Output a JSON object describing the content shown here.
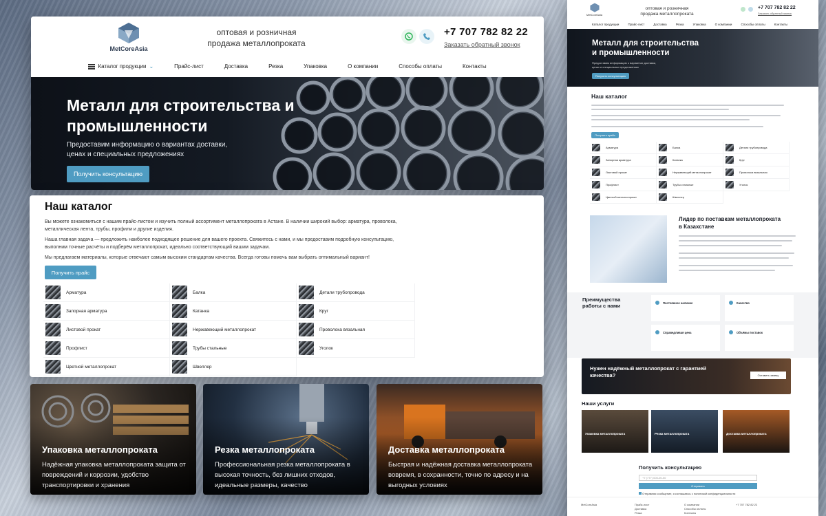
{
  "site": {
    "logo": "MetCoreAsia",
    "tagline": "оптовая и розничная продажа металлопроката",
    "phone": "+7 707 782 82 22",
    "callback": "Заказать обратный звонок",
    "nav": [
      "Каталог продукции",
      "Прайс-лист",
      "Доставка",
      "Резка",
      "Упаковка",
      "О компании",
      "Способы оплаты",
      "Контакты"
    ]
  },
  "hero": {
    "title": "Металл для строительства и промышленности",
    "subtitle": "Предоставим информацию о вариантах доставки, ценах и специальных предложениях",
    "button": "Получить консультацию"
  },
  "catalog": {
    "title": "Наш каталог",
    "p1": "Вы можете ознакомиться с нашим прайс-листом и изучить полный ассортимент металлопроката в Астане. В наличии широкий выбор: арматура, проволока, металлическая лента, трубы, профили и другие изделия.",
    "p2": "Наша главная задача — предложить наиболее подходящее решение для вашего проекта. Свяжитесь с нами, и мы предоставим подробную консультацию, выполним точные расчёты и подберём металлопрокат, идеально соответствующий вашим задачам.",
    "p3": "Мы предлагаем материалы, которые отвечают самым высоким стандартам качества. Всегда готовы помочь вам выбрать оптимальный вариант!",
    "button": "Получить прайс",
    "items": [
      "Арматура",
      "Балка",
      "Детали трубопровода",
      "Запорная арматура",
      "Катанка",
      "Круг",
      "Листовой прокат",
      "Нержавеющий металлопрокат",
      "Проволока вязальная",
      "Профлист",
      "Трубы стальные",
      "Уголок",
      "Цветной металлопрокат",
      "Швеллер"
    ]
  },
  "services": [
    {
      "title": "Упаковка металлопроката",
      "text": "Надёжная упаковка металлопроката защита от повреждений и коррозии, удобство транспортировки и хранения"
    },
    {
      "title": "Резка металлопроката",
      "text": "Профессиональная резка металлопроката в высокая точность, без лишних отходов, идеальные размеры, качество"
    },
    {
      "title": "Доставка металлопроката",
      "text": "Быстрая и надёжная доставка металлопроката вовремя, в сохранности, точно по адресу и на выгодных условиях"
    }
  ],
  "mini": {
    "nav": [
      "Каталог продукции",
      "Прайс-лист",
      "Доставка",
      "Резка",
      "Упаковка",
      "О компании",
      "Способы оплаты",
      "Контакты"
    ],
    "hero_text": "Предоставим информацию о вариантах доставки, ценах и специальных предложениях",
    "lead_title": "Лидер по поставкам металлопроката в Казахстане",
    "adv_title": "Преимущества работы с нами",
    "adv_boxes": [
      "Постоянное наличие",
      "Качество",
      "Справедливая цена",
      "Объёмы поставок"
    ],
    "cta_title": "Нужен надёжный металлопрокат с гарантией качества?",
    "cta_button": "Оставить заявку",
    "services_title": "Наши услуги",
    "service_cards": [
      "Упаковка металлопроката",
      "Резка металлопроката",
      "Доставка металлопроката"
    ],
    "consult_title": "Получить консультацию",
    "phone_placeholder": "+7 (777) 000-00-00",
    "send": "Отправить",
    "consent": "Отправляя сообщение, я соглашаюсь с политикой конфиденциальности",
    "footer_col1": [
      "Прайс-лист",
      "Доставка",
      "Резка"
    ],
    "footer_col2": [
      "О компании",
      "Способы оплаты",
      "Контакты"
    ],
    "footer_phone": "+7 707 782 82 22"
  },
  "colors": {
    "accent": "#4f9cc2",
    "dark": "#141a23"
  }
}
